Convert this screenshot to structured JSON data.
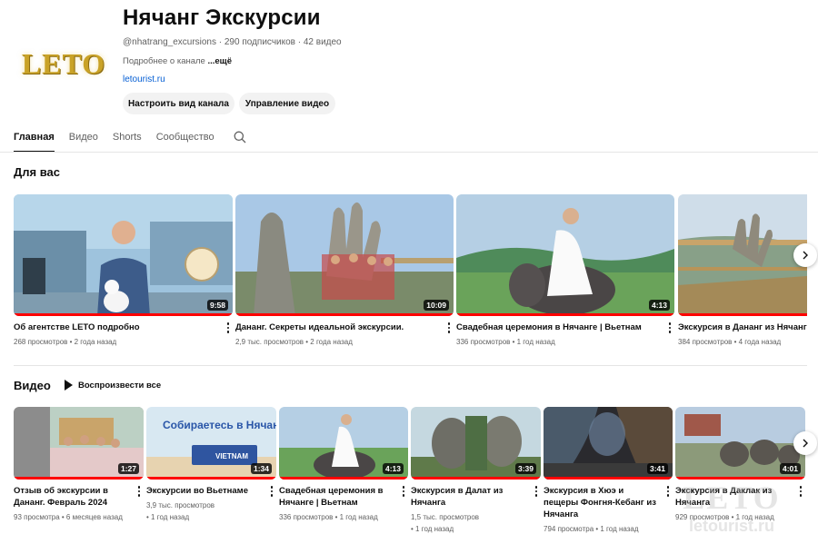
{
  "channel": {
    "logo_text": "LETO",
    "title": "Нячанг Экскурсии",
    "meta": "@nhatrang_excursions · 290 подписчиков · 42 видео",
    "desc_prefix": "Подробнее о канале ",
    "desc_more": "...ещё",
    "link": "letourist.ru",
    "customize_label": "Настроить вид канала",
    "manage_label": "Управление видео"
  },
  "tabs": [
    {
      "label": "Главная",
      "active": true
    },
    {
      "label": "Видео"
    },
    {
      "label": "Shorts"
    },
    {
      "label": "Сообщество"
    }
  ],
  "for_you": {
    "title": "Для вас",
    "videos": [
      {
        "title": "Об агентстве LETO подробно",
        "meta": "268 просмотров • 2 года назад",
        "duration": "9:58"
      },
      {
        "title": "Дананг. Секреты идеальной экскурсии.",
        "meta": "2,9 тыс. просмотров • 2 года назад",
        "duration": "10:09"
      },
      {
        "title": "Свадебная церемония в Нячанге | Вьетнам",
        "meta": "336 просмотров • 1 год назад",
        "duration": "4:13"
      },
      {
        "title": "Экскурсия в Дананг из Нячанга",
        "meta": "384 просмотров • 4 года назад",
        "duration": ""
      }
    ]
  },
  "videos_section": {
    "title": "Видео",
    "play_all": "Воспроизвести все",
    "videos": [
      {
        "title": "Отзыв об экскурсии в Дананг. Февраль 2024",
        "meta": "93 просмотра • 6 месяцев назад",
        "meta2": "",
        "duration": "1:27"
      },
      {
        "title": "Экскурсии во Вьетнаме",
        "meta": "3,9 тыс. просмотров",
        "meta2": "• 1 год назад",
        "duration": "1:34"
      },
      {
        "title": "Свадебная церемония в Нячанге | Вьетнам",
        "meta": "336 просмотров • 1 год назад",
        "meta2": "",
        "duration": "4:13"
      },
      {
        "title": "Экскурсия в Далат из Нячанга",
        "meta": "1,5 тыс. просмотров",
        "meta2": "• 1 год назад",
        "duration": "3:39"
      },
      {
        "title": "Экскурсия в Хюэ и пещеры Фонгня-Кебанг из Нячанга",
        "meta": "794 просмотра • 1 год назад",
        "meta2": "",
        "duration": "3:41"
      },
      {
        "title": "Экскурсия в Даклак из Нячанга",
        "meta": "929 просмотров • 1 год назад",
        "meta2": "",
        "duration": "4:01"
      }
    ]
  },
  "thumb_texts": {
    "plan_title": "Собираетесь в Нячанг?",
    "plan_sign": "VIETNAM"
  },
  "watermark": {
    "logo": "LETO",
    "url": "letourist.ru"
  }
}
